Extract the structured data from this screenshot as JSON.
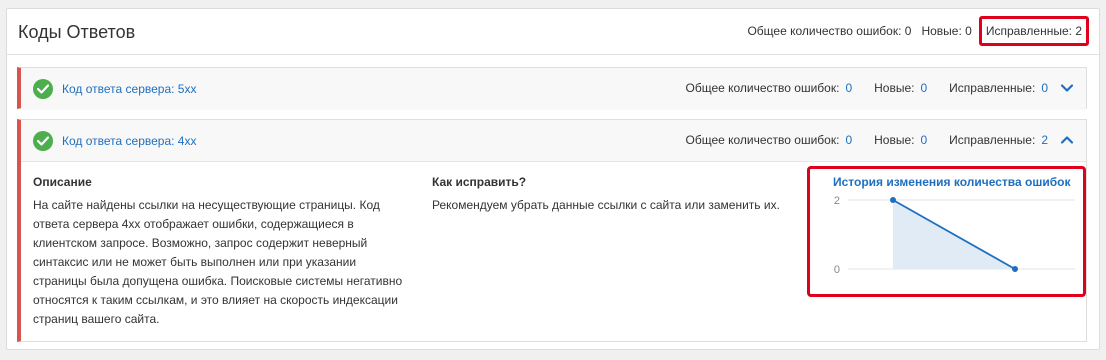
{
  "header": {
    "title": "Коды Ответов",
    "total_label": "Общее количество ошибок:",
    "total_value": "0",
    "new_label": "Новые:",
    "new_value": "0",
    "fixed_label": "Исправленные:",
    "fixed_value": "2"
  },
  "groups": [
    {
      "title": "Код ответа сервера: 5xx",
      "total_label": "Общее количество ошибок:",
      "total_value": "0",
      "new_label": "Новые:",
      "new_value": "0",
      "fixed_label": "Исправленные:",
      "fixed_value": "0",
      "expanded": false
    },
    {
      "title": "Код ответа сервера: 4xx",
      "total_label": "Общее количество ошибок:",
      "total_value": "0",
      "new_label": "Новые:",
      "new_value": "0",
      "fixed_label": "Исправленные:",
      "fixed_value": "2",
      "expanded": true,
      "description_title": "Описание",
      "description_lines": [
        "На сайте найдены ссылки на несуществующие страницы. Код",
        "ответа сервера 4xx отображает ошибки, содержащиеся в",
        "клиентском запросе. Возможно, запрос содержит неверный",
        "синтаксис или не может быть выполнен или при указании",
        "страницы была допущена ошибка. Поисковые системы негативно",
        "относятся к таким ссылкам, и это влияет на скорость индексации",
        "страниц вашего сайта."
      ],
      "fix_title": "Как исправить?",
      "fix_text": "Рекомендуем убрать данные ссылки с сайта или заменить их.",
      "history_title": "История изменения количества ошибок"
    }
  ],
  "colors": {
    "link": "#1f6fbf",
    "ok": "#4cae4c",
    "error_border": "#d9534f",
    "highlight": "#e0001b",
    "chart_fill": "#dbe8f5"
  },
  "chart_data": {
    "type": "area",
    "title": "История изменения количества ошибок",
    "x": [
      1,
      2
    ],
    "values": [
      2,
      0
    ],
    "yticks": [
      2,
      0
    ],
    "ylim": [
      0,
      2
    ],
    "grid": true
  }
}
